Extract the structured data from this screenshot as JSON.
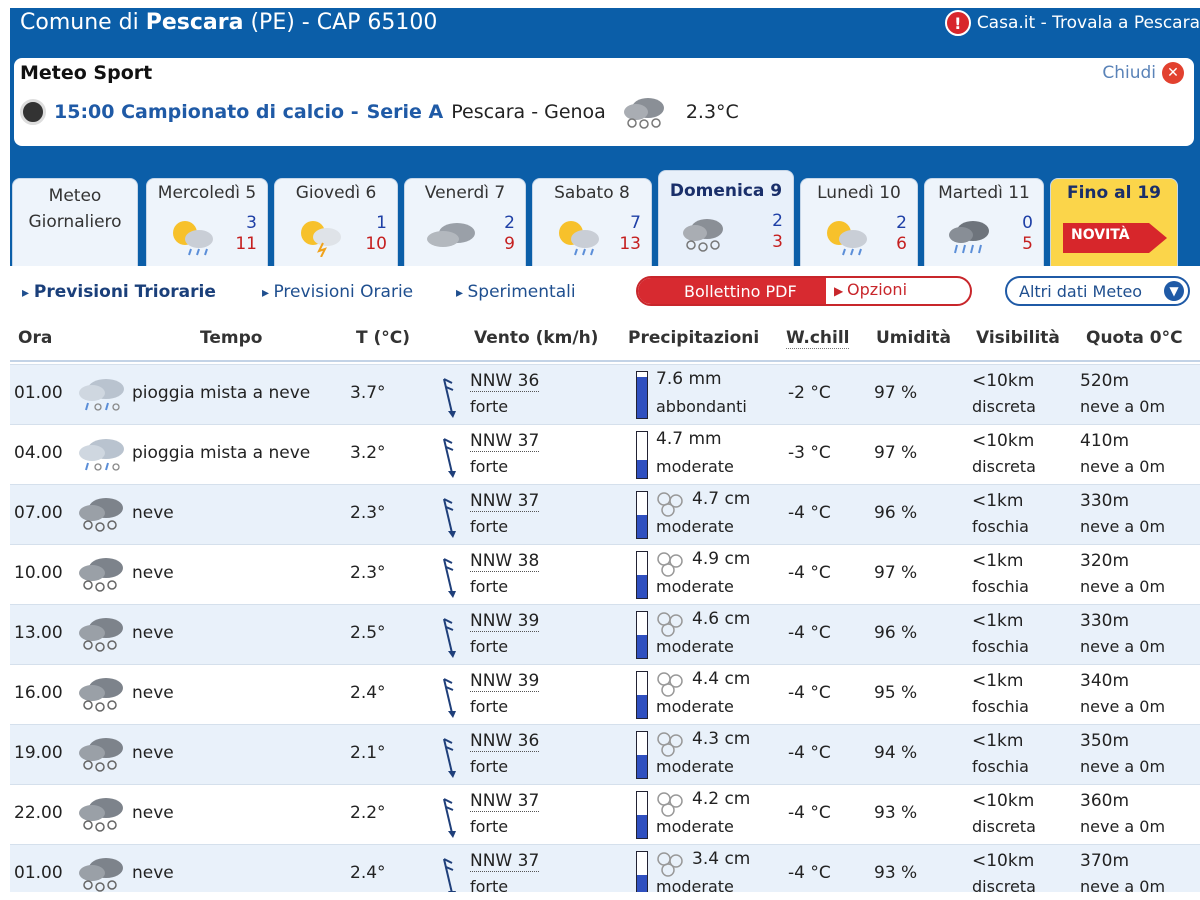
{
  "header": {
    "title_prefix": "Comune di ",
    "title_city": "Pescara",
    "title_suffix": " (PE) - CAP 65100",
    "casa_link": "Casa.it - Trovala a Pescara"
  },
  "sport": {
    "title": "Meteo Sport",
    "close_label": "Chiudi",
    "time": "15:00 Campionato di calcio -",
    "league": "Serie A",
    "teams": "Pescara - Genoa",
    "temp": "2.3°C"
  },
  "tabs": [
    {
      "name": "Meteo Giornaliero"
    },
    {
      "name": "Mercoledì 5",
      "min": "3",
      "max": "11",
      "icon": "sun-cloud-rain-icon"
    },
    {
      "name": "Giovedì 6",
      "min": "1",
      "max": "10",
      "icon": "sun-cloud-storm-icon"
    },
    {
      "name": "Venerdì 7",
      "min": "2",
      "max": "9",
      "icon": "cloud-icon"
    },
    {
      "name": "Sabato 8",
      "min": "7",
      "max": "13",
      "icon": "sun-cloud-rain-icon"
    },
    {
      "name": "Domenica 9",
      "min": "2",
      "max": "3",
      "icon": "snow-cloud-icon"
    },
    {
      "name": "Lunedì 10",
      "min": "2",
      "max": "6",
      "icon": "sun-cloud-rain-icon"
    },
    {
      "name": "Martedì 11",
      "min": "0",
      "max": "5",
      "icon": "rain-cloud-icon"
    },
    {
      "name": "Fino al 19",
      "badge": "NOVITÀ"
    }
  ],
  "subnav": {
    "triorarie": "Previsioni Triorarie",
    "orarie": "Previsioni Orarie",
    "sperimentali": "Sperimentali",
    "pdf": "Bollettino PDF",
    "opzioni": "Opzioni",
    "altri": "Altri dati Meteo"
  },
  "columns": {
    "ora": "Ora",
    "tempo": "Tempo",
    "t": "T (°C)",
    "vento": "Vento (km/h)",
    "prec": "Precipitazioni",
    "wchill": "W.chill",
    "umidita": "Umidità",
    "visibilita": "Visibilità",
    "quota": "Quota 0°C"
  },
  "rows": [
    {
      "ora": "01.00",
      "tempo": "pioggia mista a neve",
      "t": "3.7°",
      "wdir": "NNW 36",
      "wforce": "forte",
      "prec": "7.6 mm",
      "pint": "abbondanti",
      "fill": 0.9,
      "snow": false,
      "wc": "-2 °C",
      "um": "97 %",
      "vis1": "<10km",
      "vis2": "discreta",
      "q1": "520m",
      "q2": "neve a 0m"
    },
    {
      "ora": "04.00",
      "tempo": "pioggia mista a neve",
      "t": "3.2°",
      "wdir": "NNW 37",
      "wforce": "forte",
      "prec": "4.7 mm",
      "pint": "moderate",
      "fill": 0.4,
      "snow": false,
      "wc": "-3 °C",
      "um": "97 %",
      "vis1": "<10km",
      "vis2": "discreta",
      "q1": "410m",
      "q2": "neve a 0m"
    },
    {
      "ora": "07.00",
      "tempo": "neve",
      "t": "2.3°",
      "wdir": "NNW 37",
      "wforce": "forte",
      "prec": "4.7 cm",
      "pint": "moderate",
      "fill": 0.5,
      "snow": true,
      "wc": "-4 °C",
      "um": "96 %",
      "vis1": "<1km",
      "vis2": "foschia",
      "q1": "330m",
      "q2": "neve a 0m"
    },
    {
      "ora": "10.00",
      "tempo": "neve",
      "t": "2.3°",
      "wdir": "NNW 38",
      "wforce": "forte",
      "prec": "4.9 cm",
      "pint": "moderate",
      "fill": 0.5,
      "snow": true,
      "wc": "-4 °C",
      "um": "97 %",
      "vis1": "<1km",
      "vis2": "foschia",
      "q1": "320m",
      "q2": "neve a 0m"
    },
    {
      "ora": "13.00",
      "tempo": "neve",
      "t": "2.5°",
      "wdir": "NNW 39",
      "wforce": "forte",
      "prec": "4.6 cm",
      "pint": "moderate",
      "fill": 0.5,
      "snow": true,
      "wc": "-4 °C",
      "um": "96 %",
      "vis1": "<1km",
      "vis2": "foschia",
      "q1": "330m",
      "q2": "neve a 0m"
    },
    {
      "ora": "16.00",
      "tempo": "neve",
      "t": "2.4°",
      "wdir": "NNW 39",
      "wforce": "forte",
      "prec": "4.4 cm",
      "pint": "moderate",
      "fill": 0.5,
      "snow": true,
      "wc": "-4 °C",
      "um": "95 %",
      "vis1": "<1km",
      "vis2": "foschia",
      "q1": "340m",
      "q2": "neve a 0m"
    },
    {
      "ora": "19.00",
      "tempo": "neve",
      "t": "2.1°",
      "wdir": "NNW 36",
      "wforce": "forte",
      "prec": "4.3 cm",
      "pint": "moderate",
      "fill": 0.5,
      "snow": true,
      "wc": "-4 °C",
      "um": "94 %",
      "vis1": "<1km",
      "vis2": "foschia",
      "q1": "350m",
      "q2": "neve a 0m"
    },
    {
      "ora": "22.00",
      "tempo": "neve",
      "t": "2.2°",
      "wdir": "NNW 37",
      "wforce": "forte",
      "prec": "4.2 cm",
      "pint": "moderate",
      "fill": 0.5,
      "snow": true,
      "wc": "-4 °C",
      "um": "93 %",
      "vis1": "<10km",
      "vis2": "discreta",
      "q1": "360m",
      "q2": "neve a 0m"
    },
    {
      "ora": "01.00",
      "tempo": "neve",
      "t": "2.4°",
      "wdir": "NNW 37",
      "wforce": "forte",
      "prec": "3.4 cm",
      "pint": "moderate",
      "fill": 0.5,
      "snow": true,
      "wc": "-4 °C",
      "um": "93 %",
      "vis1": "<10km",
      "vis2": "discreta",
      "q1": "370m",
      "q2": "neve a 0m"
    }
  ],
  "colors": {
    "frame": "#0b5ea8",
    "min_temp": "#1e3fa6",
    "max_temp": "#c52020",
    "precip_fill": "#3050c0",
    "pdf_red": "#d72a30",
    "fino_yellow": "#fbd54a"
  }
}
